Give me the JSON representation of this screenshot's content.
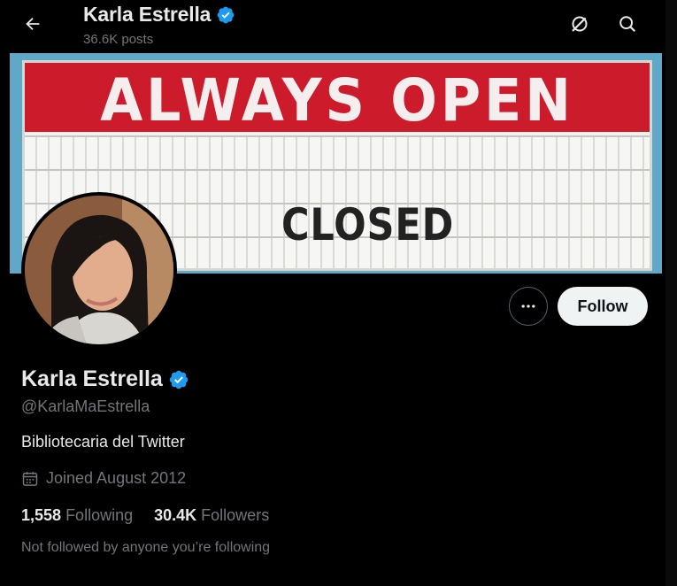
{
  "header": {
    "name": "Karla Estrella",
    "posts": "36.6K posts"
  },
  "banner": {
    "sign_top": "ALWAYS OPEN",
    "sign_bottom": "CLOSED"
  },
  "actions": {
    "follow_label": "Follow"
  },
  "profile": {
    "name": "Karla Estrella",
    "handle": "@KarlaMaEstrella",
    "bio": "Bibliotecaria del Twitter",
    "joined": "Joined August 2012",
    "following_count": "1,558",
    "following_label": "Following",
    "followers_count": "30.4K",
    "followers_label": "Followers",
    "not_followed": "Not followed by anyone you’re following"
  },
  "colors": {
    "verified": "#1d9bf0",
    "background": "#000000",
    "primary_text": "#e7e9ea",
    "secondary_text": "#71767b"
  },
  "icons": [
    "back-arrow-icon",
    "grok-icon",
    "search-icon",
    "verified-badge-icon",
    "more-icon",
    "calendar-icon"
  ]
}
